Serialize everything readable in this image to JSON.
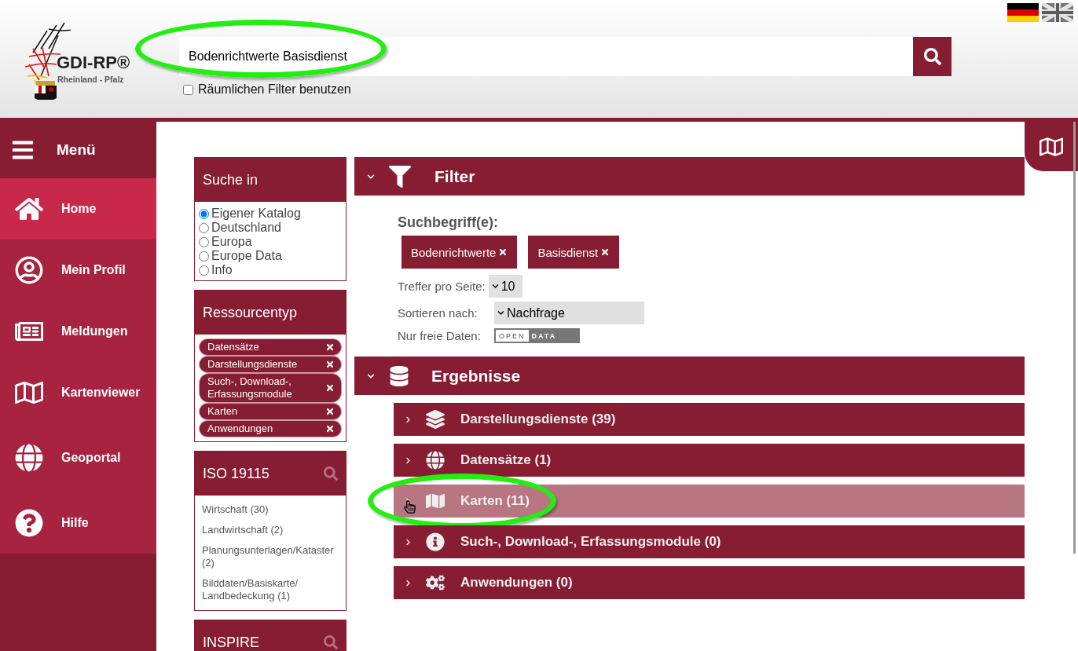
{
  "header": {
    "logo": {
      "title": "GDI-RP®",
      "subtitle": "Rheinland - Pfalz"
    },
    "search": {
      "value": "Bodenrichtwerte Basisdienst",
      "highlighted": true
    },
    "spatial_filter": {
      "label": "Räumlichen Filter benutzen",
      "checked": false
    },
    "languages": [
      {
        "kind": "de",
        "selected": true
      },
      {
        "kind": "en",
        "selected": false
      }
    ]
  },
  "sidebar": {
    "title": "Menü",
    "items": [
      {
        "label": "Home",
        "kind": "home",
        "selected": true
      },
      {
        "label": "Mein Profil",
        "kind": "profile",
        "selected": false
      },
      {
        "label": "Meldungen",
        "kind": "news",
        "selected": false
      },
      {
        "label": "Kartenviewer",
        "kind": "map",
        "selected": false
      },
      {
        "label": "Geoportal",
        "kind": "globe",
        "selected": false
      },
      {
        "label": "Hilfe",
        "kind": "help",
        "selected": false
      }
    ]
  },
  "search_in": {
    "title": "Suche in",
    "options": [
      {
        "label": "Eigener Katalog",
        "selected": true
      },
      {
        "label": "Deutschland",
        "selected": false
      },
      {
        "label": "Europa",
        "selected": false
      },
      {
        "label": "Europe Data",
        "selected": false
      },
      {
        "label": "Info",
        "selected": false
      }
    ]
  },
  "resource_type": {
    "title": "Ressourcentyp",
    "tags": [
      "Datensätze",
      "Darstellungsdienste",
      "Such-, Download-, Erfassungsmodule",
      "Karten",
      "Anwendungen"
    ]
  },
  "iso": {
    "title": "ISO 19115",
    "items": [
      "Wirtschaft (30)",
      "Landwirtschaft (2)",
      "Planungsunterlagen/Kataster (2)",
      "Bilddaten/Basiskarte/ Landbedeckung (1)"
    ]
  },
  "inspire": {
    "title": "INSPIRE"
  },
  "filter": {
    "title": "Filter",
    "expanded": true,
    "terms_label": "Suchbegriff(e):",
    "terms": [
      "Bodenrichtwerte",
      "Basisdienst"
    ],
    "per_page": {
      "label": "Treffer pro Seite:",
      "value": "10"
    },
    "sort": {
      "label": "Sortieren nach:",
      "value": "Nachfrage"
    },
    "open_data": {
      "label": "Nur freie Daten:",
      "left": "OPEN",
      "right": "DATA",
      "on": false
    }
  },
  "results": {
    "title": "Ergebnisse",
    "expanded": true,
    "groups": [
      {
        "label": "Darstellungsdienste (39)",
        "kind": "layers",
        "hovered": false,
        "highlighted": false
      },
      {
        "label": "Datensätze (1)",
        "kind": "globe",
        "hovered": false,
        "highlighted": false
      },
      {
        "label": "Karten (11)",
        "kind": "map",
        "hovered": true,
        "highlighted": true
      },
      {
        "label": "Such-, Download-, Erfassungsmodule (0)",
        "kind": "info",
        "hovered": false,
        "highlighted": false
      },
      {
        "label": "Anwendungen (0)",
        "kind": "cogs",
        "hovered": false,
        "highlighted": false
      }
    ]
  }
}
